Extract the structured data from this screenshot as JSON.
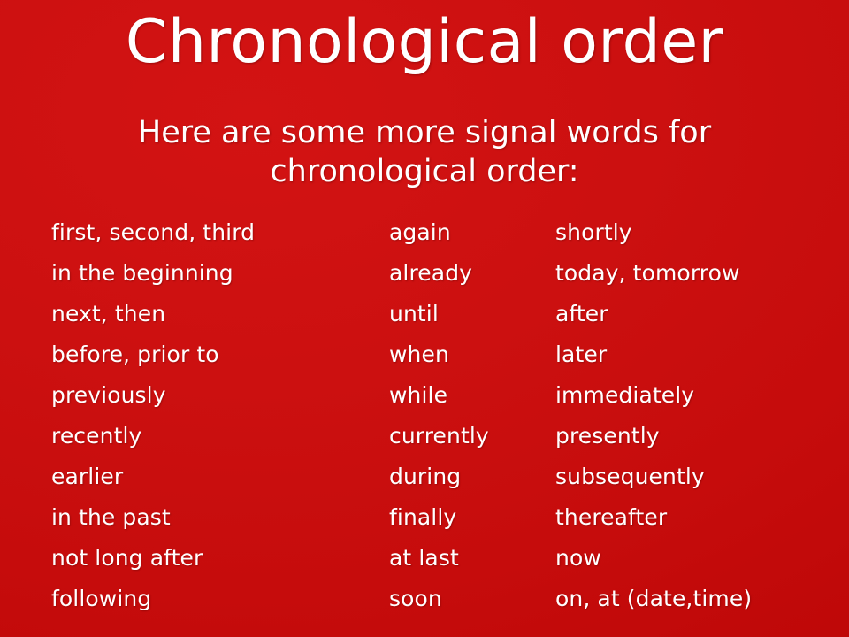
{
  "slide": {
    "background_color": "#cc1010",
    "text_color": "#ffffff",
    "title": "Chronological order",
    "subtitle": "Here are some more signal words for chronological order:"
  },
  "columns": [
    {
      "name": "column-1",
      "items": [
        "first, second, third",
        "in the beginning",
        "next, then",
        "before, prior to",
        "previously",
        "recently",
        "earlier",
        "in the past",
        "not long after",
        "following"
      ]
    },
    {
      "name": "column-2",
      "items": [
        "again",
        "already",
        "until",
        "when",
        "while",
        "currently",
        "during",
        "finally",
        "at last",
        "soon"
      ]
    },
    {
      "name": "column-3",
      "items": [
        "shortly",
        "today, tomorrow",
        "after",
        "later",
        "immediately",
        "presently",
        "subsequently",
        "thereafter",
        "now",
        "on, at (date,time)"
      ]
    }
  ]
}
